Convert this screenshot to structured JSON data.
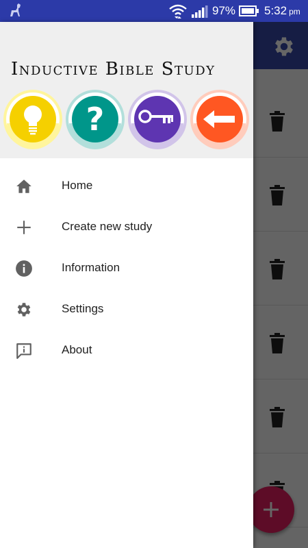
{
  "status_bar": {
    "battery": "97%",
    "time": "5:32",
    "ampm": "pm",
    "icons": [
      "app-notification-icon",
      "wifi-icon",
      "signal-icon",
      "battery-icon"
    ]
  },
  "drawer": {
    "header_title": "Inductive Bible Study",
    "header_badges": [
      {
        "icon": "lightbulb-icon",
        "color": "#f5d000"
      },
      {
        "icon": "question-mark-icon",
        "color": "#00968a"
      },
      {
        "icon": "key-icon",
        "color": "#5e35b1"
      },
      {
        "icon": "arrow-left-icon",
        "color": "#ff5722"
      }
    ],
    "items": [
      {
        "label": "Home",
        "icon": "home-icon"
      },
      {
        "label": "Create new study",
        "icon": "plus-icon"
      },
      {
        "label": "Information",
        "icon": "info-icon"
      },
      {
        "label": "Settings",
        "icon": "gear-icon"
      },
      {
        "label": "About",
        "icon": "feedback-icon"
      }
    ]
  },
  "background": {
    "toolbar_icon": "settings-icon",
    "row_icon": "trash-icon",
    "fab_icon": "add-icon"
  },
  "colors": {
    "status_bar": "#2c3aa8",
    "toolbar": "#3949ab",
    "fab": "#e91e63",
    "icon_gray": "#616161"
  }
}
